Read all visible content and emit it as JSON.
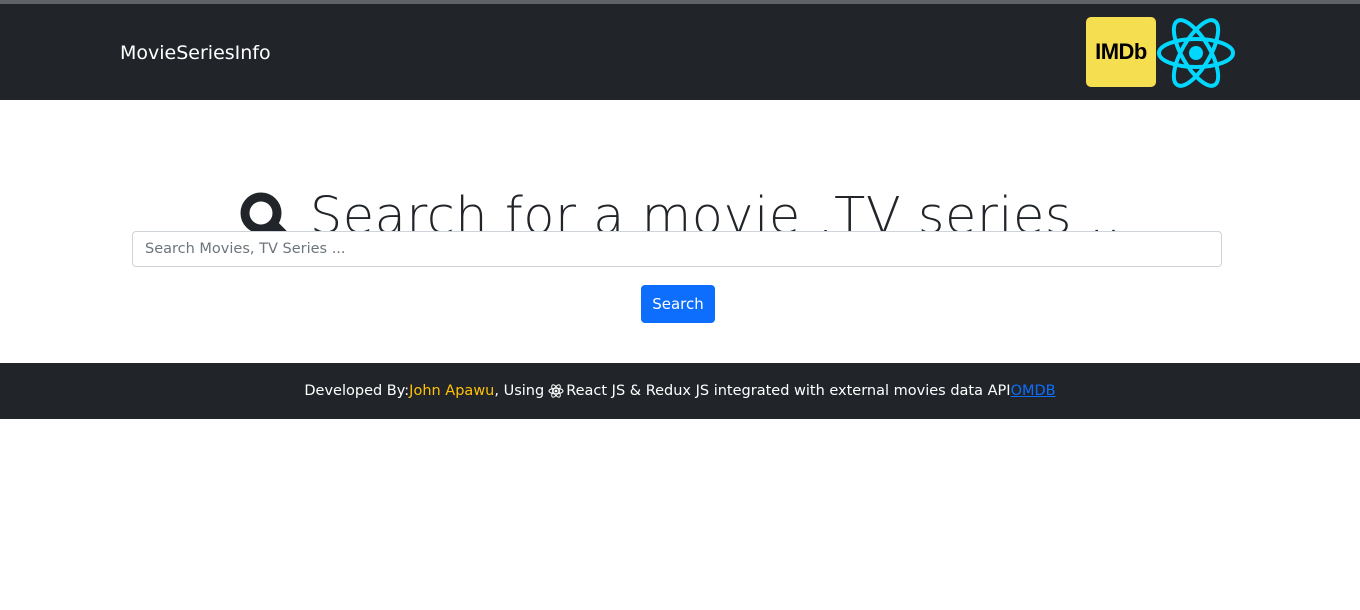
{
  "navbar": {
    "brand": "MovieSeriesInfo",
    "imdb_logo_text": "IMDb",
    "react_logo_icon": "react-atom-icon",
    "colors": {
      "background": "#212529",
      "imdb_yellow": "#f5de50",
      "react_cyan": "#00d8ff"
    }
  },
  "hero": {
    "icon": "magnifier-icon",
    "title": "Search for a movie ,TV series .."
  },
  "search": {
    "placeholder": "Search Movies, TV Series ...",
    "value": "",
    "button_label": "Search",
    "button_color": "#0d6efd"
  },
  "footer": {
    "developed_by": "Developed By:",
    "author": "John Apawu",
    "using": ", Using",
    "react_icon": "react-atom-icon",
    "tech": "React JS & Redux JS integrated with external movies data API",
    "api_link": "OMDB",
    "colors": {
      "author": "#ffc107",
      "link": "#0d6efd"
    }
  }
}
